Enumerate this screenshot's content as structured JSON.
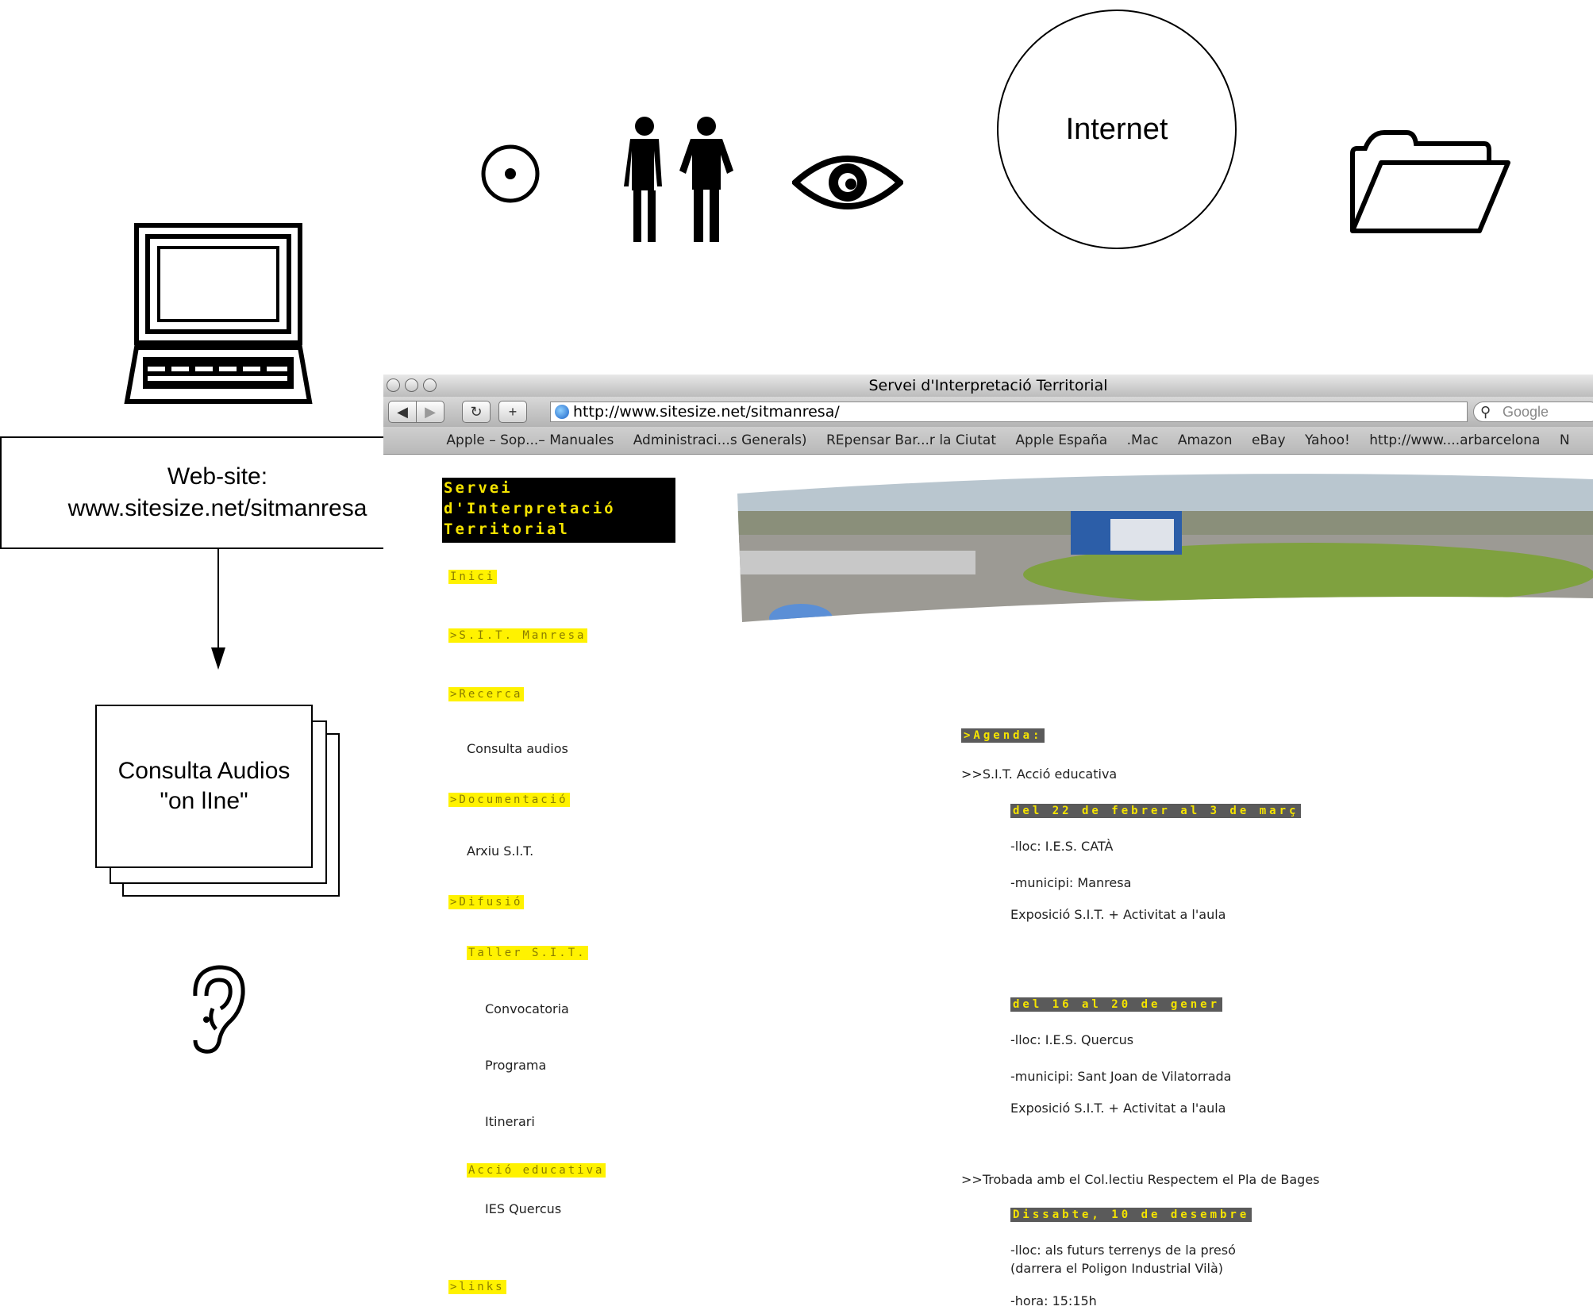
{
  "diagram": {
    "website_box": {
      "line1": "Web-site:",
      "line2": "www.sitesize.net/sitmanresa"
    },
    "audio_doc": {
      "line1": "Consulta Audios",
      "line2": "\"on lIne\""
    },
    "internet": "Internet"
  },
  "browser": {
    "window_title": "Servei d'Interpretació Territorial",
    "url": "http://www.sitesize.net/sitmanresa/",
    "search_placeholder": "Google",
    "bookmarks": [
      "Apple – Sop...– Manuales",
      "Administraci...s Generals)",
      "REpensar Bar...r la Ciutat",
      "Apple España",
      ".Mac",
      "Amazon",
      "eBay",
      "Yahoo!",
      "http://www....arbarcelona",
      "N"
    ]
  },
  "page": {
    "logo": "Servei\nd'Interpretació\nTerritorial",
    "nav": {
      "inici": "Inici",
      "sit_manresa": ">S.I.T. Manresa",
      "recerca": ">Recerca",
      "consulta_audios": "Consulta audios",
      "documentacio": ">Documentació",
      "arxiu": "Arxiu S.I.T.",
      "difusio": ">Difusió",
      "taller": "Taller S.I.T.",
      "convocatoria": "Convocatoria",
      "programa": "Programa",
      "itinerari": "Itinerari",
      "accio_educativa": "Acció educativa",
      "ies_quercus": "IES Quercus",
      "links": ">links"
    },
    "agenda": {
      "heading": ">Agenda:",
      "item1_title": ">>S.I.T. Acció educativa",
      "date1": "del 22 de febrer al 3 de març",
      "lloc1": "-lloc: I.E.S. CATÀ",
      "municipi1": "-municipi: Manresa",
      "expo1": "Exposició S.I.T. + Activitat a l'aula",
      "date2": "del 16 al 20 de gener",
      "lloc2": "-lloc: I.E.S. Quercus",
      "municipi2": "-municipi: Sant Joan de Vilatorrada",
      "expo2": "Exposició S.I.T. + Activitat a l'aula",
      "item2_title": ">>Trobada amb el Col.lectiu Respectem el Pla de Bages",
      "date3": "Dissabte, 10 de desembre",
      "lloc3a": "-lloc: als futurs terrenys de la presó",
      "lloc3b": "(darrera el Poligon Industrial Vilà)",
      "hora3": "-hora: 15:15h"
    }
  }
}
